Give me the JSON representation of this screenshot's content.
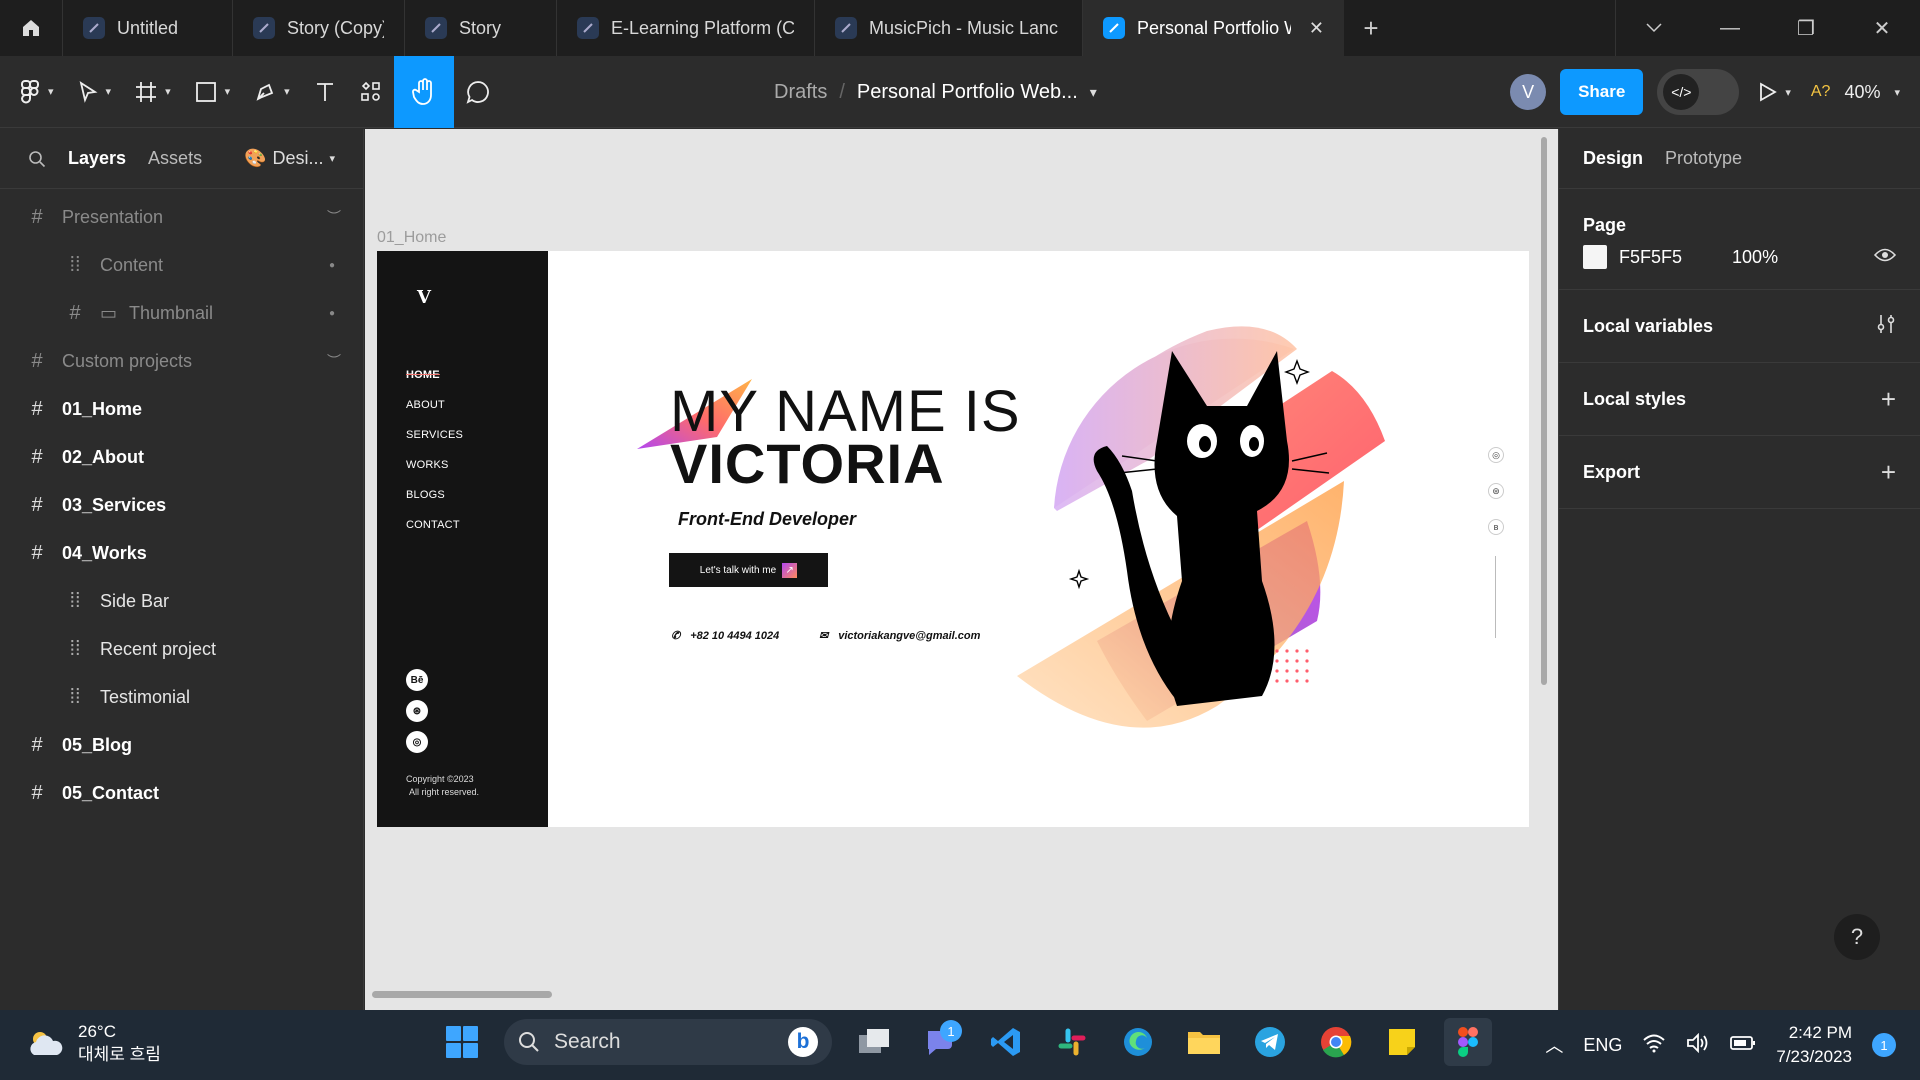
{
  "tabs": [
    {
      "label": "Untitled",
      "active": false
    },
    {
      "label": "Story (Copy)",
      "active": false
    },
    {
      "label": "Story",
      "active": false
    },
    {
      "label": "E-Learning Platform (C",
      "active": false
    },
    {
      "label": "MusicPich - Music Lanc",
      "active": false
    },
    {
      "label": "Personal Portfolio W",
      "active": true
    }
  ],
  "toolbar": {
    "breadcrumb_root": "Drafts",
    "breadcrumb_sep": "/",
    "file_name": "Personal Portfolio Web...",
    "avatar_letter": "V",
    "share_label": "Share",
    "missing_fonts": "A?",
    "zoom": "40%"
  },
  "left_panel": {
    "tab_layers": "Layers",
    "tab_assets": "Assets",
    "page_selector": "Desi...",
    "layers": [
      {
        "name": "Presentation",
        "kind": "top dim",
        "hidden": true
      },
      {
        "name": "Content",
        "kind": "child dim",
        "icon": "section"
      },
      {
        "name": "Thumbnail",
        "kind": "grandchild dim"
      },
      {
        "name": "Custom projects",
        "kind": "top dim",
        "hidden": true
      },
      {
        "name": "01_Home",
        "kind": "top bold"
      },
      {
        "name": "02_About",
        "kind": "top bold"
      },
      {
        "name": "03_Services",
        "kind": "top bold"
      },
      {
        "name": "04_Works",
        "kind": "top bold"
      },
      {
        "name": "Side Bar",
        "kind": "child"
      },
      {
        "name": "Recent project",
        "kind": "child"
      },
      {
        "name": "Testimonial",
        "kind": "child"
      },
      {
        "name": "05_Blog",
        "kind": "top bold"
      },
      {
        "name": "05_Contact",
        "kind": "top bold"
      }
    ]
  },
  "canvas": {
    "frame_label": "01_Home",
    "design": {
      "logo": "V",
      "nav": [
        "HOME",
        "ABOUT",
        "SERVICES",
        "WORKS",
        "BLOGS",
        "CONTACT"
      ],
      "socials": [
        "Bē",
        "⊛",
        "◎"
      ],
      "copyright_line1": "Copyright ©2023",
      "copyright_line2": "All right reserved.",
      "title_line1": "MY NAME IS",
      "title_line2": "VICTORIA",
      "subtitle": "Front-End Developer",
      "cta_label": "Let's talk with me",
      "phone": "+82 10 4494 1024",
      "email": "victoriakangve@gmail.com",
      "accent_colors": [
        "#b247f0",
        "#ff6b6b",
        "#ffb38a"
      ]
    }
  },
  "right_panel": {
    "tab_design": "Design",
    "tab_prototype": "Prototype",
    "page_heading": "Page",
    "page_color": "F5F5F5",
    "page_opacity": "100%",
    "local_variables": "Local variables",
    "local_styles": "Local styles",
    "export": "Export",
    "help": "?"
  },
  "taskbar": {
    "temperature": "26°C",
    "weather_desc": "대체로 흐림",
    "search_placeholder": "Search",
    "teams_badge": "1",
    "language": "ENG",
    "time": "2:42 PM",
    "date": "7/23/2023",
    "notification_count": "1"
  }
}
